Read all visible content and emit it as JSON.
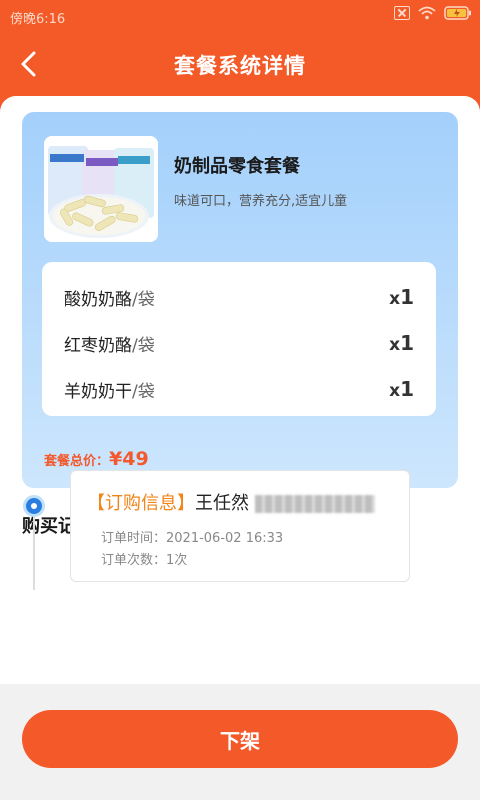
{
  "status_bar": {
    "time": "傍晚6:16"
  },
  "navbar": {
    "title": "套餐系统详情"
  },
  "package": {
    "name": "奶制品零食套餐",
    "description": "味道可口，营养充分,适宜儿童",
    "image_brand_text": "世蒙牧",
    "items": [
      {
        "name": "酸奶奶酪",
        "unit": "/袋",
        "qty_prefix": "x",
        "qty": "1"
      },
      {
        "name": "红枣奶酪",
        "unit": "/袋",
        "qty_prefix": "x",
        "qty": "1"
      },
      {
        "name": "羊奶奶干",
        "unit": "/袋",
        "qty_prefix": "x",
        "qty": "1"
      }
    ],
    "total_label": "套餐总价：",
    "total_price": "¥49"
  },
  "records": {
    "title": "购买记录",
    "entries": [
      {
        "tag": "【订购信息】",
        "buyer": "王任然",
        "order_time_label": "订单时间：",
        "order_time": "2021-06-02 16:33",
        "order_count_label": "订单次数：",
        "order_count": "1次"
      }
    ]
  },
  "actions": {
    "delist_label": "下架"
  },
  "colors": {
    "accent": "#f35a28",
    "tag": "#f08519",
    "timeline": "#2a7de1"
  }
}
